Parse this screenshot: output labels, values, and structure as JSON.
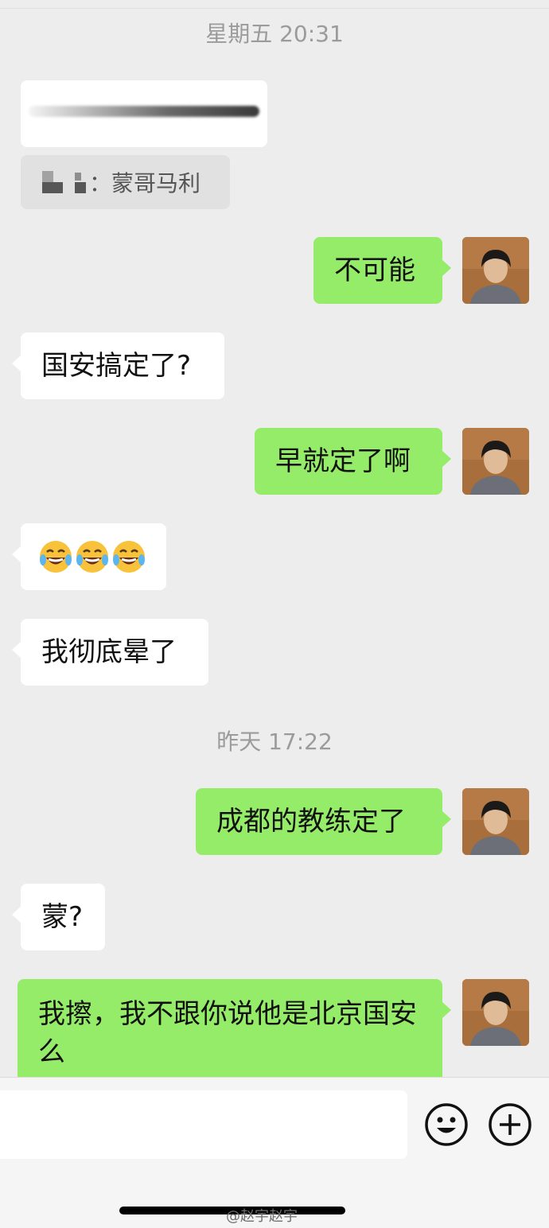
{
  "timestamps": {
    "first": "星期五 20:31",
    "second": "昨天 17:22"
  },
  "quote": {
    "text": "：蒙哥马利"
  },
  "messages": {
    "m1": "不可能",
    "m2": "国安搞定了?",
    "m3": "早就定了啊",
    "m4": "😂😂😂",
    "m5": "我彻底晕了",
    "m6": "成都的教练定了",
    "m7": "蒙?",
    "m8": "我擦，我不跟你说他是北京国安么"
  },
  "watermark": "@赵宇赵宇",
  "icons": {
    "emoji_button": "smile-icon",
    "more_button": "plus-circle-icon"
  },
  "colors": {
    "background": "#ededed",
    "incoming_bubble": "#ffffff",
    "outgoing_bubble": "#95ec69"
  }
}
